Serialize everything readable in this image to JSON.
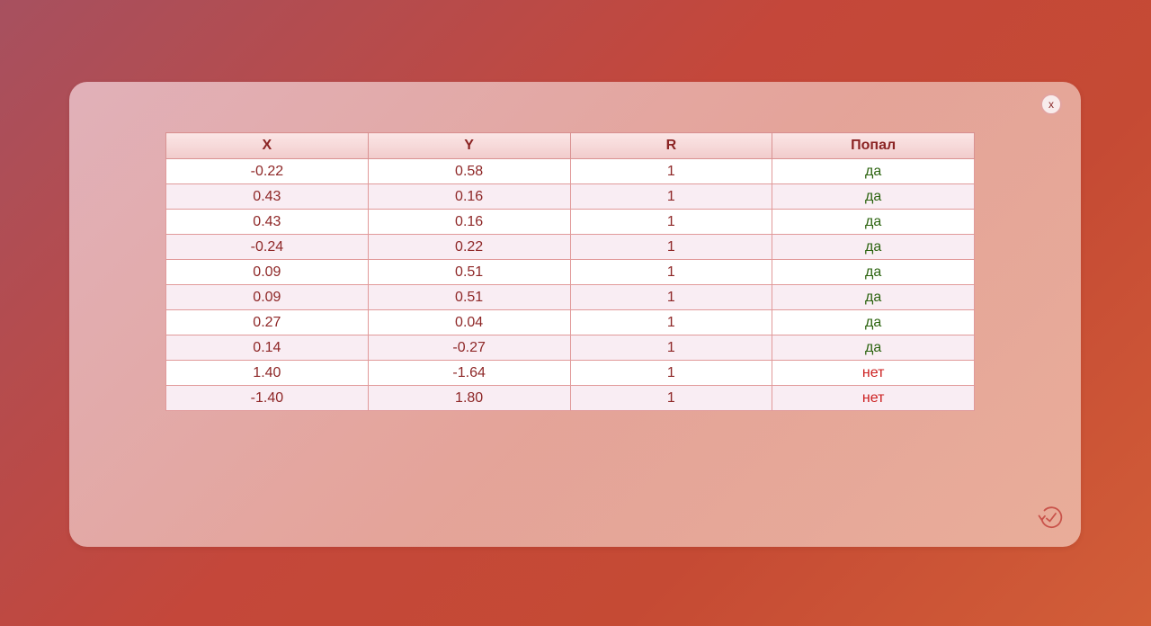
{
  "dialog": {
    "close_label": "x",
    "history_icon": "history-icon"
  },
  "table": {
    "columns": [
      "X",
      "Y",
      "R",
      "Попал"
    ],
    "rows": [
      {
        "x": "-0.22",
        "y": "0.58",
        "r": "1",
        "hit": "да"
      },
      {
        "x": "0.43",
        "y": "0.16",
        "r": "1",
        "hit": "да"
      },
      {
        "x": "0.43",
        "y": "0.16",
        "r": "1",
        "hit": "да"
      },
      {
        "x": "-0.24",
        "y": "0.22",
        "r": "1",
        "hit": "да"
      },
      {
        "x": "0.09",
        "y": "0.51",
        "r": "1",
        "hit": "да"
      },
      {
        "x": "0.09",
        "y": "0.51",
        "r": "1",
        "hit": "да"
      },
      {
        "x": "0.27",
        "y": "0.04",
        "r": "1",
        "hit": "да"
      },
      {
        "x": "0.14",
        "y": "-0.27",
        "r": "1",
        "hit": "да"
      },
      {
        "x": "1.40",
        "y": "-1.64",
        "r": "1",
        "hit": "нет"
      },
      {
        "x": "-1.40",
        "y": "1.80",
        "r": "1",
        "hit": "нет"
      }
    ]
  },
  "colors": {
    "hit_yes": "#2c6410",
    "hit_no": "#cc1f1f",
    "text": "#8e2727"
  }
}
